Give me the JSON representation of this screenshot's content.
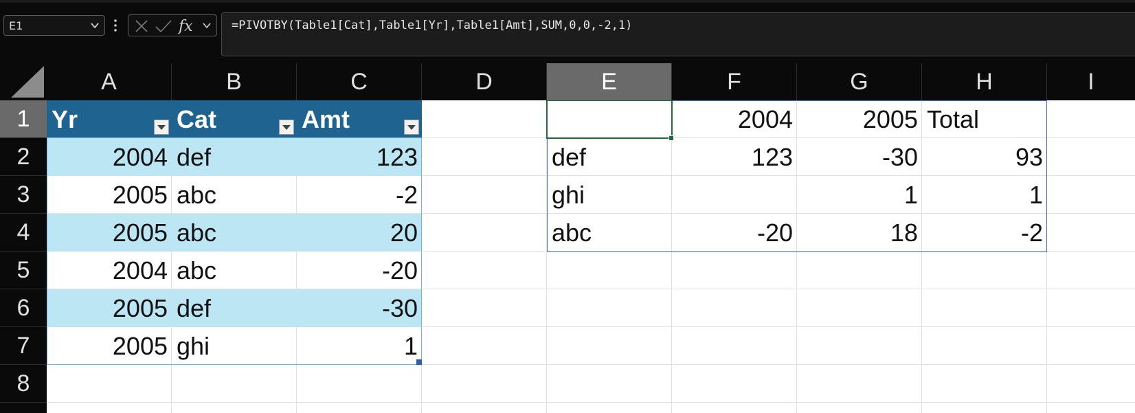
{
  "name_box": {
    "value": "E1"
  },
  "formula": {
    "text": "=PIVOTBY(Table1[Cat],Table1[Yr],Table1[Amt],SUM,0,0,-2,1)"
  },
  "columns": [
    "A",
    "B",
    "C",
    "D",
    "E",
    "F",
    "G",
    "H",
    "I"
  ],
  "selected_column": "E",
  "rows": [
    "1",
    "2",
    "3",
    "4",
    "5",
    "6",
    "7",
    "8"
  ],
  "selected_row": "1",
  "table1": {
    "headers": [
      "Yr",
      "Cat",
      "Amt"
    ],
    "rows": [
      [
        "2004",
        "def",
        "123"
      ],
      [
        "2005",
        "abc",
        "-2"
      ],
      [
        "2005",
        "abc",
        "20"
      ],
      [
        "2004",
        "abc",
        "-20"
      ],
      [
        "2005",
        "def",
        "-30"
      ],
      [
        "2005",
        "ghi",
        "1"
      ]
    ]
  },
  "pivot": {
    "header": [
      "",
      "2004",
      "2005",
      "Total"
    ],
    "rows": [
      [
        "def",
        "123",
        "-30",
        "93"
      ],
      [
        "ghi",
        "",
        "1",
        "1"
      ],
      [
        "abc",
        "-20",
        "18",
        "-2"
      ]
    ]
  },
  "colors": {
    "table_header": "#1f6391",
    "table_band": "#bde6f5",
    "active_cell": "#1e6e3a",
    "pivot_border": "#4d6fd0"
  },
  "icons": [
    "chevron-down-icon",
    "more-options-icon",
    "cancel-icon",
    "enter-icon",
    "insert-function-icon",
    "select-all-icon",
    "filter-dropdown-icon"
  ]
}
